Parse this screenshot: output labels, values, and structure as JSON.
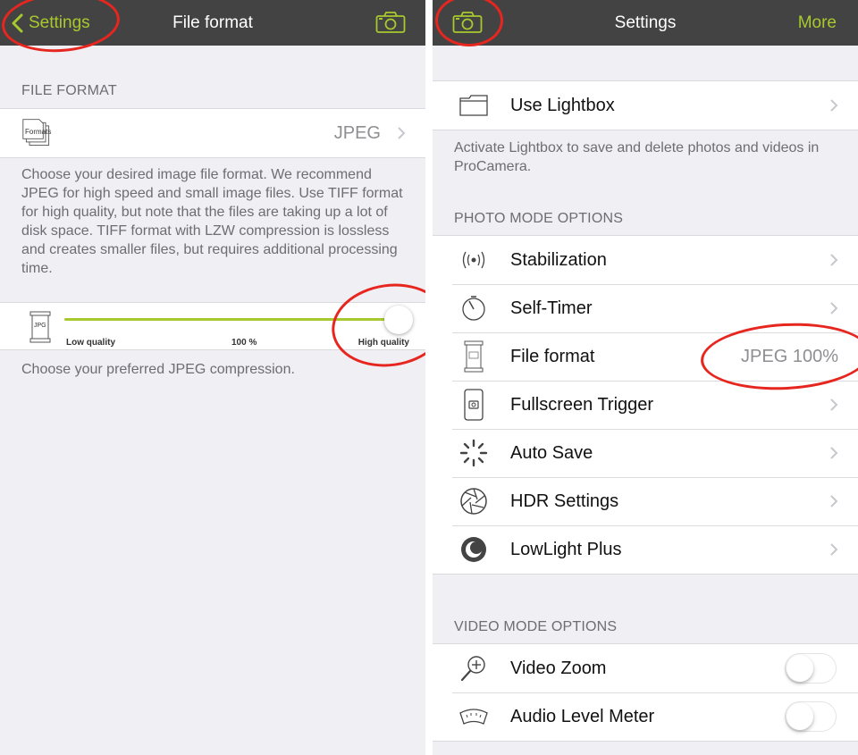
{
  "left_panel": {
    "nav": {
      "back_label": "Settings",
      "title": "File format",
      "right_icon": "camera-icon"
    },
    "file_format_header": "FILE FORMAT",
    "format_row": {
      "icon_text": "Formats",
      "value": "JPEG"
    },
    "format_description": "Choose your desired image file format. We recommend JPEG for high speed and small image files. Use TIFF format for high quality, but note that the files are taking up a lot of disk space. TIFF format with LZW compression is lossless and creates smaller files, but requires additional processing time.",
    "quality_slider": {
      "icon_text": "JPG",
      "low_label": "Low quality",
      "value_label": "100 %",
      "high_label": "High quality",
      "value_percent": 100
    },
    "compression_description": "Choose your preferred JPEG compression."
  },
  "right_panel": {
    "nav": {
      "left_icon": "camera-icon",
      "title": "Settings",
      "more_label": "More"
    },
    "lightbox_row": {
      "label": "Use Lightbox",
      "icon": "folder-icon"
    },
    "lightbox_description": "Activate Lightbox to save and delete photos and videos in ProCamera.",
    "photo_header": "PHOTO MODE OPTIONS",
    "photo_items": [
      {
        "label": "Stabilization",
        "icon": "stabilization-icon",
        "value": ""
      },
      {
        "label": "Self-Timer",
        "icon": "timer-icon",
        "value": ""
      },
      {
        "label": "File format",
        "icon": "jpeg-file-icon",
        "value": "JPEG 100%"
      },
      {
        "label": "Fullscreen Trigger",
        "icon": "phone-camera-icon",
        "value": ""
      },
      {
        "label": "Auto Save",
        "icon": "spinner-icon",
        "value": ""
      },
      {
        "label": "HDR Settings",
        "icon": "aperture-icon",
        "value": ""
      },
      {
        "label": "LowLight Plus",
        "icon": "night-mode-icon",
        "value": ""
      }
    ],
    "video_header": "VIDEO MODE OPTIONS",
    "video_items": [
      {
        "label": "Video Zoom",
        "icon": "zoom-in-icon",
        "toggle": false
      },
      {
        "label": "Audio Level Meter",
        "icon": "level-meter-icon",
        "toggle": false
      }
    ]
  },
  "colors": {
    "accent": "#a8c92e",
    "navbar": "#434343",
    "highlight_ring": "#e6261f",
    "background": "#efeff4"
  }
}
